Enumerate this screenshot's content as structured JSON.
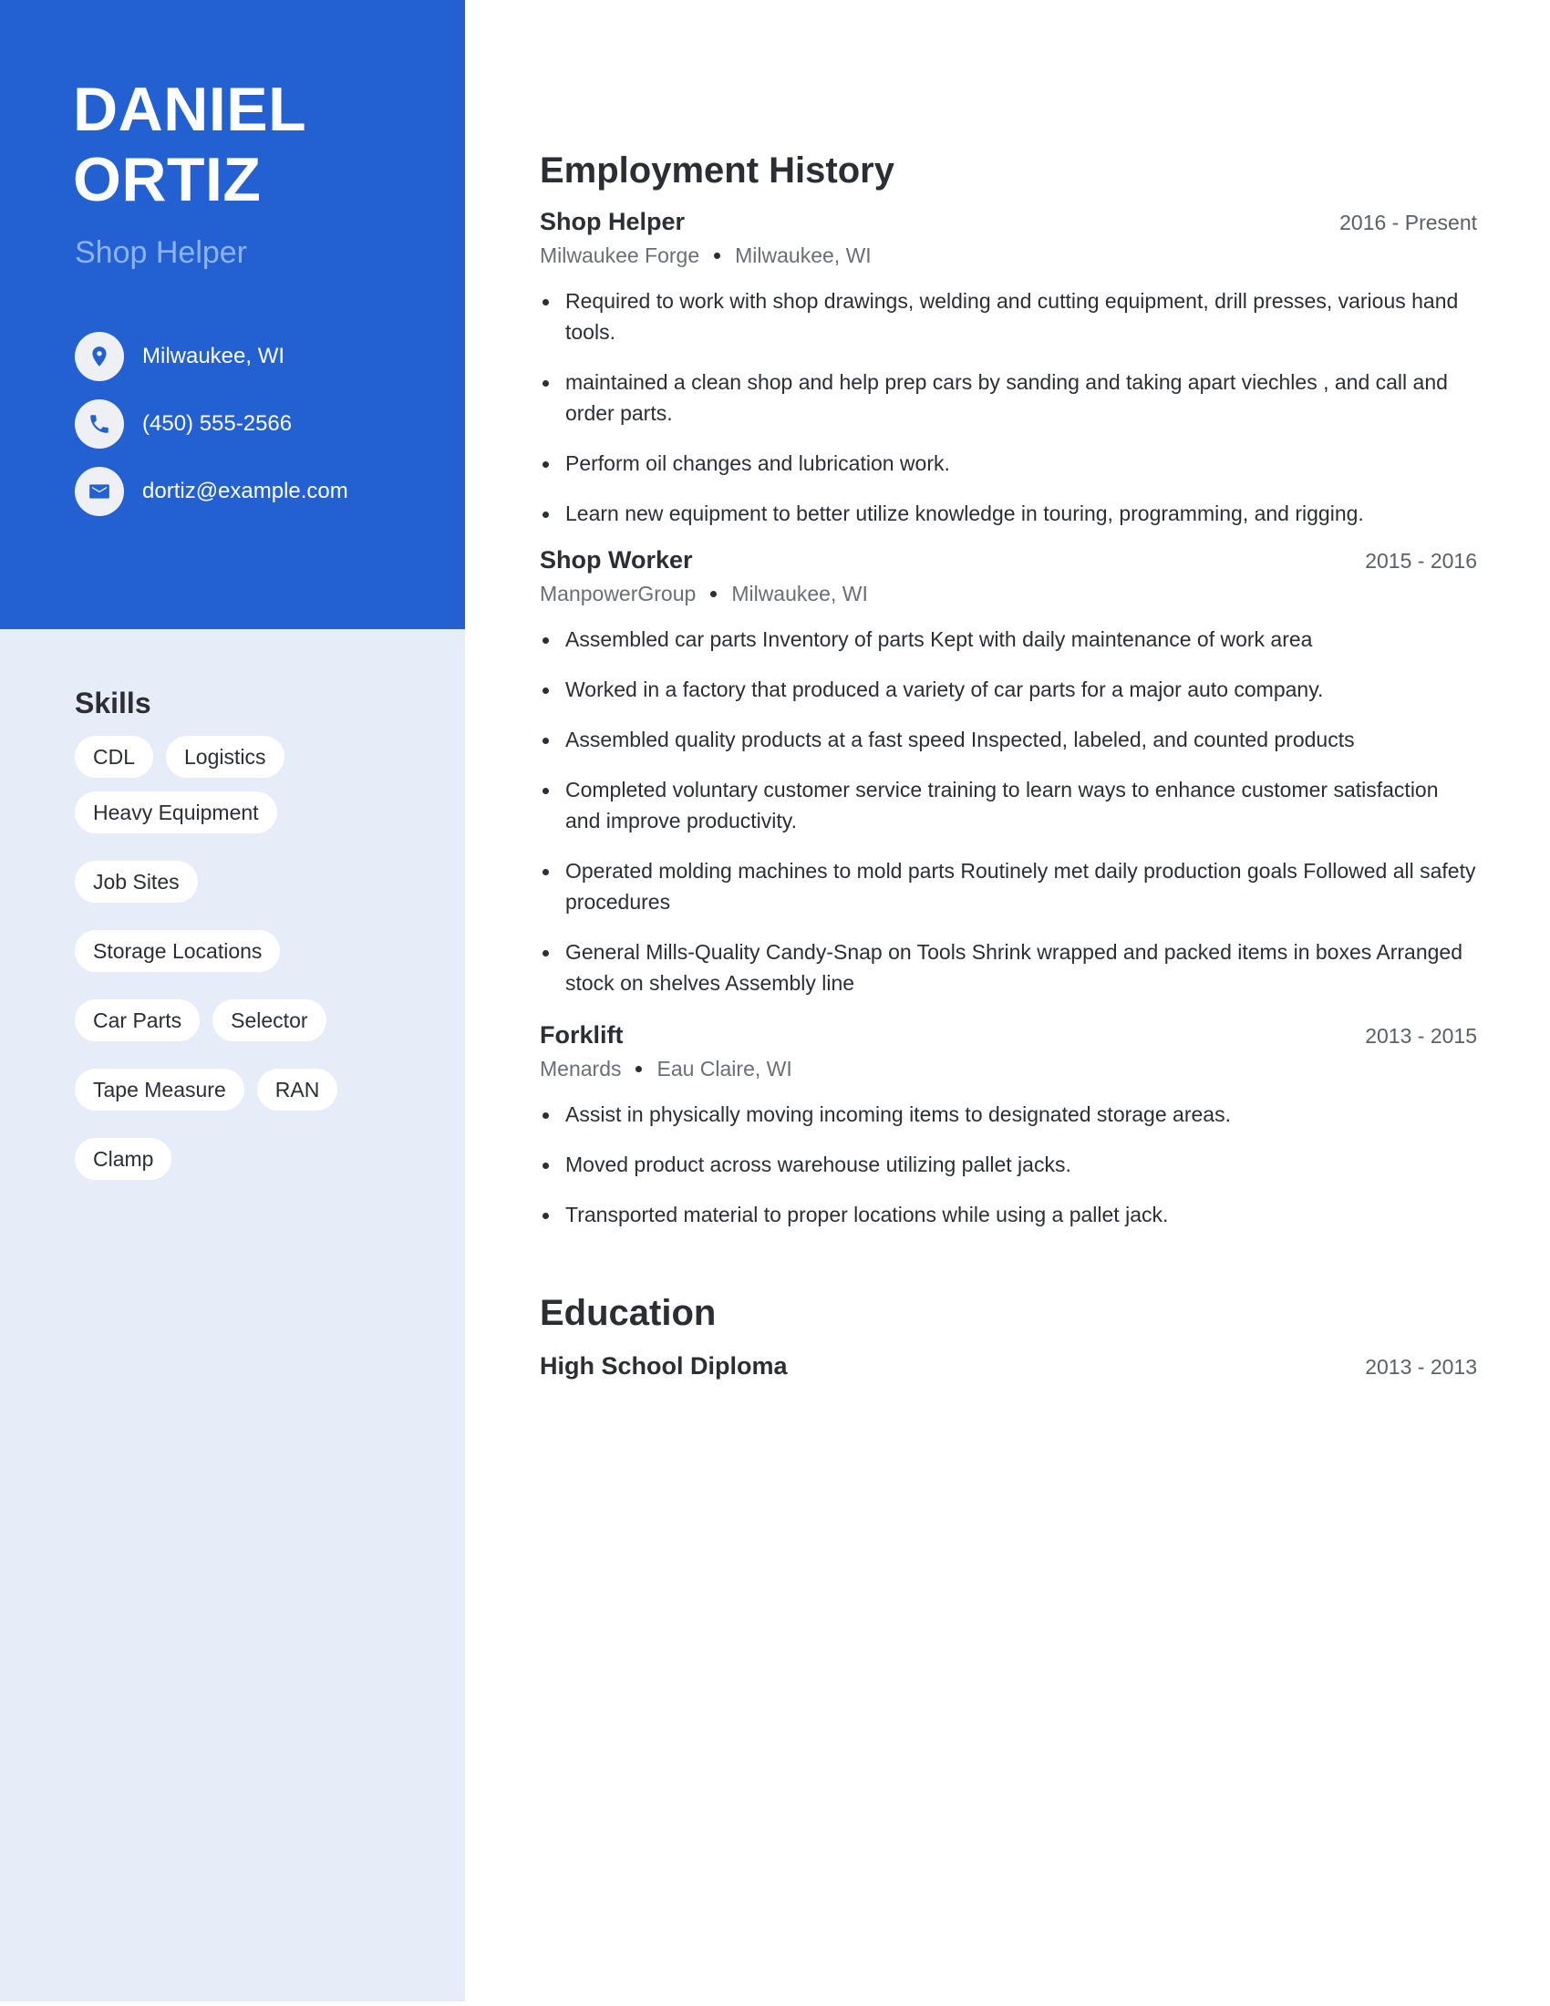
{
  "profile": {
    "first_name": "DANIEL",
    "last_name": "ORTIZ",
    "title": "Shop Helper"
  },
  "contact": {
    "location": {
      "icon": "location-pin-icon",
      "text": "Milwaukee, WI"
    },
    "phone": {
      "icon": "phone-icon",
      "text": "(450) 555-2566"
    },
    "email": {
      "icon": "mail-icon",
      "text": "dortiz@example.com"
    }
  },
  "skills": {
    "title": "Skills",
    "items": [
      "CDL",
      "Logistics",
      "Heavy Equipment",
      "Job Sites",
      "Storage Locations",
      "Car Parts",
      "Selector",
      "Tape Measure",
      "RAN",
      "Clamp"
    ]
  },
  "employment": {
    "title": "Employment History",
    "jobs": [
      {
        "title": "Shop Helper",
        "dates": "2016 - Present",
        "company": "Milwaukee Forge",
        "location": "Milwaukee, WI",
        "bullets": [
          "Required to work with shop drawings, welding and cutting equipment, drill presses, various hand tools.",
          "maintained a clean shop and help prep cars by sanding and taking apart viechles , and call and order parts.",
          "Perform oil changes and lubrication work.",
          "Learn new equipment to better utilize knowledge in touring, programming, and rigging."
        ]
      },
      {
        "title": "Shop Worker",
        "dates": "2015 - 2016",
        "company": "ManpowerGroup",
        "location": "Milwaukee, WI",
        "bullets": [
          "Assembled car parts Inventory of parts Kept with daily maintenance of work area",
          "Worked in a factory that produced a variety of car parts for a major auto company.",
          "Assembled quality products at a fast speed Inspected, labeled, and counted products",
          "Completed voluntary customer service training to learn ways to enhance customer satisfaction and improve productivity.",
          "Operated molding machines to mold parts Routinely met daily production goals Followed all safety procedures",
          "General Mills-Quality Candy-Snap on Tools Shrink wrapped and packed items in boxes Arranged stock on shelves Assembly line"
        ]
      },
      {
        "title": "Forklift",
        "dates": "2013 - 2015",
        "company": "Menards",
        "location": "Eau Claire, WI",
        "bullets": [
          "Assist in physically moving incoming items to designated storage areas.",
          "Moved product across warehouse utilizing pallet jacks.",
          "Transported material to proper locations while using a pallet jack."
        ]
      }
    ]
  },
  "education": {
    "title": "Education",
    "entries": [
      {
        "degree": "High School Diploma",
        "dates": "2013 - 2013"
      }
    ]
  },
  "colors": {
    "accent": "#2360d2",
    "sidebar_bg": "#e6edf9",
    "subtitle": "#8fb2f1",
    "text": "#2c2e33",
    "muted": "#6b6e74"
  }
}
